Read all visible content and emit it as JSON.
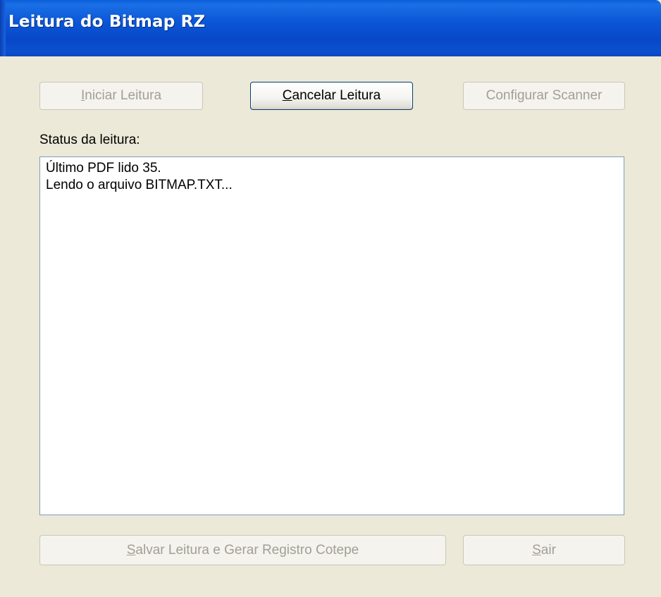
{
  "window": {
    "title": "Leitura do Bitmap RZ"
  },
  "toolbar": {
    "start_label_mnemonic": "I",
    "start_label_rest": "niciar Leitura",
    "cancel_label_mnemonic": "C",
    "cancel_label_rest": "ancelar Leitura",
    "configure_label": "Configurar Scanner"
  },
  "status": {
    "heading": "Status da leitura:",
    "lines": [
      "Último PDF lido 35.",
      "Lendo o arquivo BITMAP.TXT..."
    ]
  },
  "footer": {
    "save_label_mnemonic": "S",
    "save_label_rest": "alvar Leitura e Gerar Registro Cotepe",
    "exit_label_mnemonic": "S",
    "exit_label_rest": "air"
  },
  "colors": {
    "titlebar": "#0a56d6",
    "window_bg": "#ece9d8",
    "disabled_text": "#a19f95",
    "focus_border": "#003c74"
  }
}
